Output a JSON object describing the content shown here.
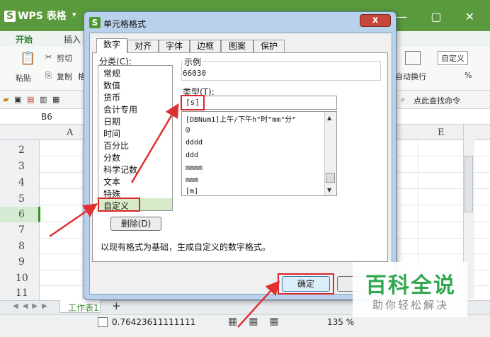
{
  "app": {
    "logo_letter": "S",
    "title": "WPS 表格",
    "dropdown": "▾",
    "window_controls": "▭ — ▢ ✕"
  },
  "ribbon": {
    "tabs": [
      "开始",
      "插入"
    ],
    "paste": "粘贴",
    "cut": "剪切",
    "copy": "复制",
    "format_painter": "格",
    "wrap_text": "自动换行",
    "number_format": "自定义",
    "percent": "%",
    "find_command": "点此查找命令"
  },
  "formula_bar": {
    "cell_ref": "B6"
  },
  "sheet": {
    "columns": [
      "A",
      "E"
    ],
    "rows": [
      "2",
      "3",
      "4",
      "5",
      "6",
      "7",
      "8",
      "9",
      "10",
      "11"
    ],
    "tab_label": "工作表1",
    "add_label": "+"
  },
  "status": {
    "sum": "0.76423611111111",
    "zoom": "135 %"
  },
  "dialog": {
    "logo_letter": "S",
    "title": "单元格格式",
    "close": "x",
    "tabs": [
      "数字",
      "对齐",
      "字体",
      "边框",
      "图案",
      "保护"
    ],
    "category_label": "分类(C):",
    "categories": [
      "常规",
      "数值",
      "货币",
      "会计专用",
      "日期",
      "时间",
      "百分比",
      "分数",
      "科学记数",
      "文本",
      "特殊",
      "自定义"
    ],
    "sample_label": "示例",
    "sample_value": "66030",
    "type_label": "类型(T):",
    "type_value": "[s]",
    "format_list": [
      "[DBNum1]上午/下午h\"时\"mm\"分\"",
      "@",
      "dddd",
      "ddd",
      "mmmm",
      "mmm",
      "[m]"
    ],
    "delete_button": "删除(D)",
    "description": "以现有格式为基础，生成自定义的数字格式。",
    "ok_button": "确定"
  },
  "watermark": {
    "title": "百科全说",
    "subtitle": "助你轻松解决"
  },
  "colors": {
    "highlight_red": "#d8272a",
    "wps_green": "#5a9a3c",
    "selected_green": "#d7ebc8"
  }
}
